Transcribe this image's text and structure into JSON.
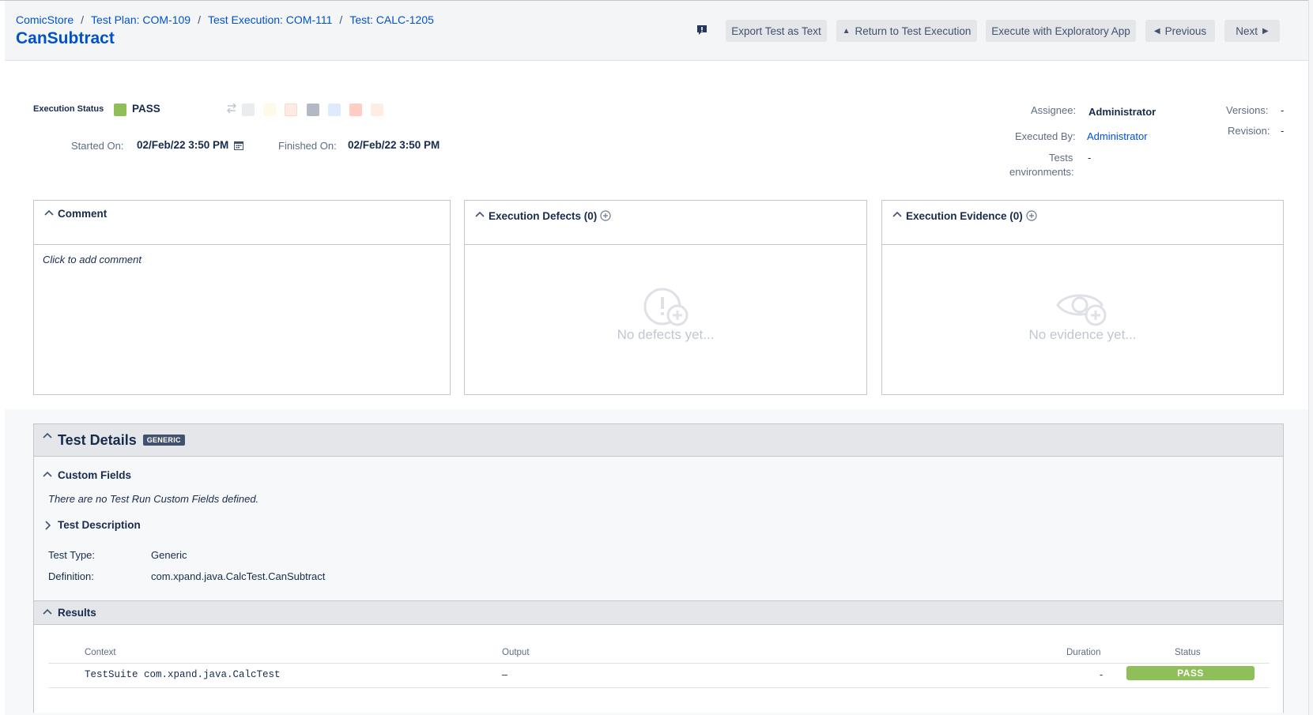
{
  "breadcrumb": [
    {
      "label": "ComicStore"
    },
    {
      "label": "Test Plan: COM-109"
    },
    {
      "label": "Test Execution: COM-111"
    },
    {
      "label": "Test: CALC-1205"
    }
  ],
  "title": "CanSubtract",
  "toolbar": {
    "export_label": "Export Test as Text",
    "return_label": "Return to Test Execution",
    "exploratory_label": "Execute with Exploratory App",
    "previous_label": "Previous",
    "next_label": "Next"
  },
  "execution": {
    "status_label": "Execution Status",
    "status_value": "PASS",
    "status_color": "#8fbf59",
    "other_status_colors": [
      "#ebecf0",
      "#fffae6",
      "#ffebe6",
      "#c1c7d0",
      "#deebff",
      "#ffbdad",
      "#ffebe6"
    ],
    "started_label": "Started On:",
    "started_value": "02/Feb/22 3:50 PM",
    "finished_label": "Finished On:",
    "finished_value": "02/Feb/22 3:50 PM"
  },
  "meta": {
    "assignee_label": "Assignee:",
    "assignee_value": "Administrator",
    "executed_by_label": "Executed By:",
    "executed_by_value": "Administrator",
    "tests_env_label_1": "Tests",
    "tests_env_label_2": "environments:",
    "tests_env_value": "-",
    "versions_label": "Versions:",
    "versions_value": "-",
    "revision_label": "Revision:",
    "revision_value": "-"
  },
  "panels": {
    "comment_title": "Comment",
    "comment_placeholder": "Click to add comment",
    "defects_title": "Execution Defects (0)",
    "defects_empty": "No defects yet...",
    "evidence_title": "Execution Evidence (0)",
    "evidence_empty": "No evidence yet..."
  },
  "details": {
    "title": "Test Details",
    "badge": "GENERIC",
    "custom_fields_title": "Custom Fields",
    "custom_fields_empty": "There are no Test Run Custom Fields defined.",
    "description_title": "Test Description",
    "test_type_label": "Test Type:",
    "test_type_value": "Generic",
    "definition_label": "Definition:",
    "definition_value": "com.xpand.java.CalcTest.CanSubtract"
  },
  "results": {
    "title": "Results",
    "columns": {
      "context": "Context",
      "output": "Output",
      "duration": "Duration",
      "status": "Status"
    },
    "rows": [
      {
        "context": "TestSuite com.xpand.java.CalcTest",
        "output": "–",
        "duration": "-",
        "status": "PASS"
      }
    ]
  }
}
